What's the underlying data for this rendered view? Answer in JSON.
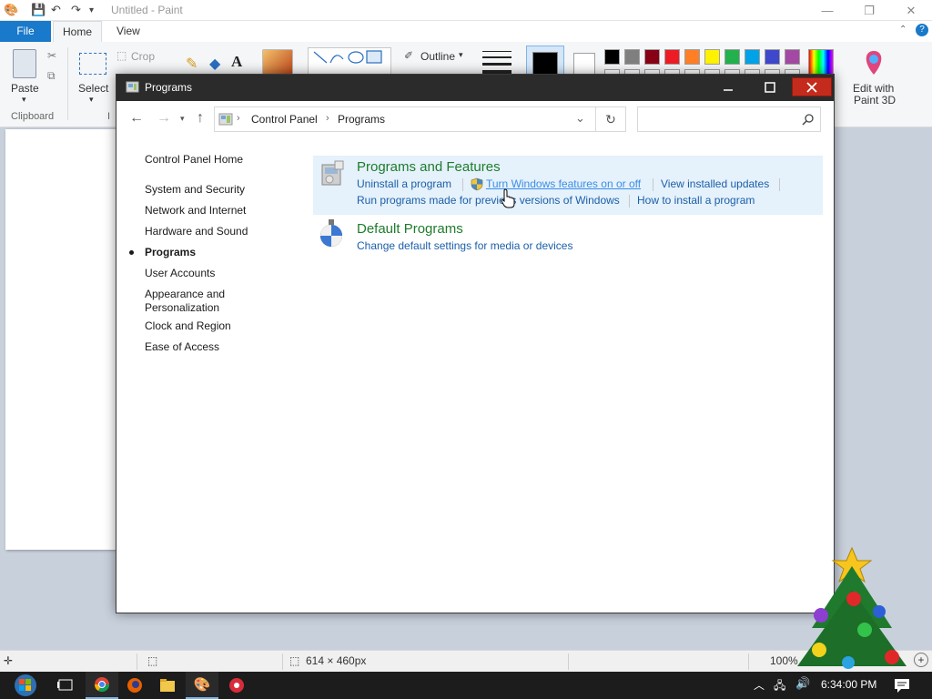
{
  "paint": {
    "title": "Untitled - Paint",
    "tabs": [
      "File",
      "Home",
      "View"
    ],
    "ribbon": {
      "paste": "Paste",
      "select": "Select",
      "crop": "Crop",
      "outline": "Outline",
      "clipboard_group": "Clipboard",
      "edit_paint3d_line1": "Edit with",
      "edit_paint3d_line2": "Paint 3D"
    },
    "palette": [
      "#000000",
      "#7f7f7f",
      "#880015",
      "#ed1c24",
      "#ff7f27",
      "#fff200",
      "#22b14c",
      "#00a2e8",
      "#3f48cc",
      "#a349a4"
    ],
    "primary_color": "#000000",
    "status": {
      "dimensions": "614 × 460px",
      "zoom": "100%"
    }
  },
  "control_panel": {
    "title": "Programs",
    "breadcrumb": [
      "Control Panel",
      "Programs"
    ],
    "search_placeholder": "",
    "nav": {
      "home": "Control Panel Home",
      "items": [
        "System and Security",
        "Network and Internet",
        "Hardware and Sound",
        "Programs",
        "User Accounts",
        "Appearance and",
        "Personalization",
        "Clock and Region",
        "Ease of Access"
      ]
    },
    "categories": [
      {
        "title": "Programs and Features",
        "links": [
          "Uninstall a program",
          "Turn Windows features on or off",
          "View installed updates",
          "Run programs made for previous versions of Windows",
          "How to install a program"
        ]
      },
      {
        "title": "Default Programs",
        "links": [
          "Change default settings for media or devices"
        ]
      }
    ]
  },
  "taskbar": {
    "time": "6:34:00 PM"
  }
}
